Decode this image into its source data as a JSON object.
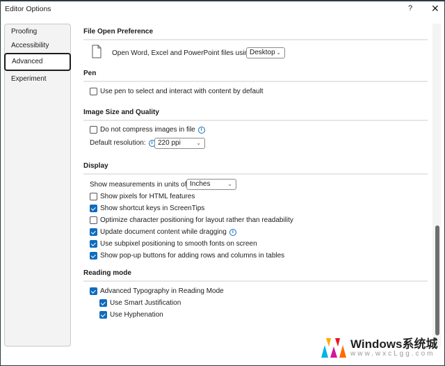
{
  "window": {
    "title": "Editor Options",
    "help": "?",
    "close": "✕"
  },
  "sidebar": {
    "items": [
      {
        "label": "Proofing"
      },
      {
        "label": "Accessibility"
      },
      {
        "label": "Advanced",
        "selected": true
      },
      {
        "label": "Experiment"
      }
    ]
  },
  "sections": {
    "file_open": {
      "heading": "File Open Preference",
      "label": "Open Word, Excel and PowerPoint files using:",
      "value": "Desktop"
    },
    "pen": {
      "heading": "Pen",
      "use_pen": {
        "label": "Use pen to select and interact with content by default",
        "checked": false
      }
    },
    "image": {
      "heading": "Image Size and Quality",
      "no_compress": {
        "label": "Do not compress images in file",
        "checked": false
      },
      "resolution_label": "Default resolution:",
      "resolution_value": "220 ppi"
    },
    "display": {
      "heading": "Display",
      "units_label": "Show measurements in units of:",
      "units_value": "Inches",
      "options": [
        {
          "label": "Show pixels for HTML features",
          "checked": false
        },
        {
          "label": "Show shortcut keys in ScreenTips",
          "checked": true
        },
        {
          "label": "Optimize character positioning for layout rather than readability",
          "checked": false
        },
        {
          "label": "Update document content while dragging",
          "checked": true,
          "info": true
        },
        {
          "label": "Use subpixel positioning to smooth fonts on screen",
          "checked": true
        },
        {
          "label": "Show pop-up buttons for adding rows and columns in tables",
          "checked": true
        }
      ]
    },
    "reading": {
      "heading": "Reading mode",
      "options": [
        {
          "label": "Advanced Typography in Reading Mode",
          "checked": true
        },
        {
          "label": "Use Smart Justification",
          "checked": true
        },
        {
          "label": "Use Hyphenation",
          "checked": true
        }
      ]
    }
  },
  "scrollbar": {
    "position_percent": 70
  },
  "watermark": {
    "text": "Windows系统城",
    "url": "www.wxcLgg.com"
  },
  "colors": {
    "accent": "#0f6cbd"
  }
}
